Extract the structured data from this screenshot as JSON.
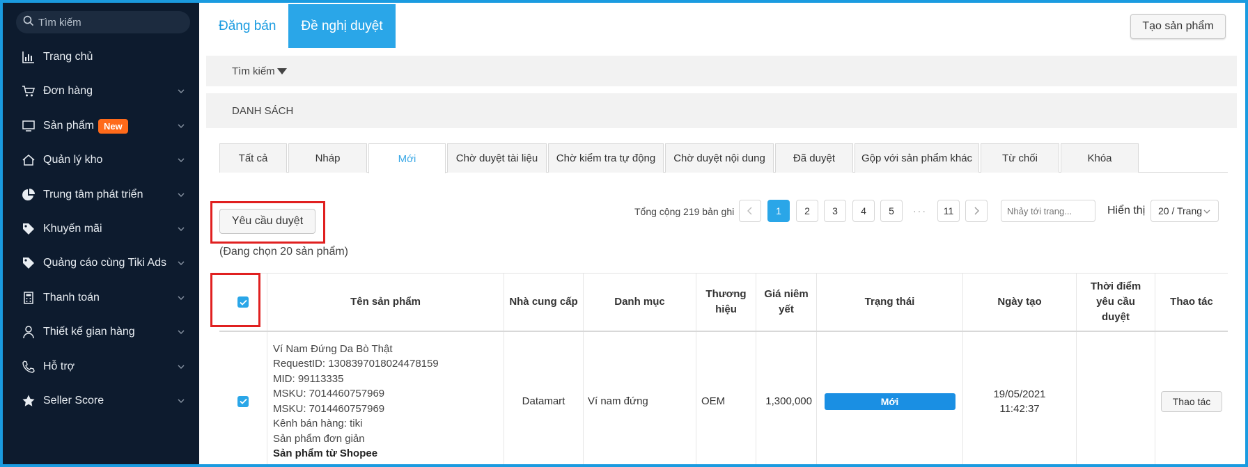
{
  "sidebar": {
    "search_placeholder": "Tìm kiếm",
    "items": [
      {
        "label": "Trang chủ",
        "icon": "chart-icon"
      },
      {
        "label": "Đơn hàng",
        "icon": "cart-icon"
      },
      {
        "label": "Sản phẩm",
        "icon": "monitor-icon",
        "badge": "New"
      },
      {
        "label": "Quản lý kho",
        "icon": "home-icon"
      },
      {
        "label": "Trung tâm phát triển",
        "icon": "pie-icon"
      },
      {
        "label": "Khuyến mãi",
        "icon": "tag-icon"
      },
      {
        "label": "Quảng cáo cùng Tiki Ads",
        "icon": "tag-icon"
      },
      {
        "label": "Thanh toán",
        "icon": "calculator-icon"
      },
      {
        "label": "Thiết kế gian hàng",
        "icon": "person-icon"
      },
      {
        "label": "Hỗ trợ",
        "icon": "phone-icon"
      },
      {
        "label": "Seller Score",
        "icon": "star-icon"
      }
    ]
  },
  "top_tabs": [
    "Đăng bán",
    "Đề nghị duyệt"
  ],
  "create_button": "Tạo sản phẩm",
  "search_bar": "Tìm kiếm",
  "list_bar": "DANH SÁCH",
  "status_tabs": [
    "Tất cả",
    "Nháp",
    "Mới",
    "Chờ duyệt tài liệu",
    "Chờ kiểm tra tự động",
    "Chờ duyệt nội dung",
    "Đã duyệt",
    "Gộp với sản phẩm khác",
    "Từ chối",
    "Khóa"
  ],
  "request_button": "Yêu cầu duyệt",
  "selected_note": "(Đang chọn 20 sản phẩm)",
  "pagination": {
    "total": "Tổng cộng 219 bản ghi",
    "pages": [
      "1",
      "2",
      "3",
      "4",
      "5",
      "···",
      "11"
    ],
    "current": "1",
    "jump_placeholder": "Nhảy tới trang...",
    "show_label": "Hiển thị",
    "page_size": "20 / Trang"
  },
  "table": {
    "headers": {
      "name": "Tên sản phẩm",
      "supplier": "Nhà cung cấp",
      "category": "Danh mục",
      "brand_1": "Thương",
      "brand_2": "hiệu",
      "price_1": "Giá niêm",
      "price_2": "yết",
      "status": "Trạng thái",
      "created": "Ngày tạo",
      "req_1": "Thời điểm",
      "req_2": "yêu cầu",
      "req_3": "duyệt",
      "action": "Thao tác"
    },
    "rows": [
      {
        "lines": [
          "Ví Nam Đứng Da Bò Thật",
          "RequestID: 1308397018024478159",
          "MID: 99113335",
          "MSKU: 7014460757969",
          "MSKU: 7014460757969",
          "Kênh bán hàng: tiki",
          "Sản phẩm đơn giản"
        ],
        "source": "Sản phẩm từ Shopee",
        "supplier": "Datamart",
        "category": "Ví nam đứng",
        "brand": "OEM",
        "price": "1,300,000",
        "status": "Mới",
        "created_date": "19/05/2021",
        "created_time": "11:42:37",
        "action": "Thao tác"
      }
    ]
  }
}
